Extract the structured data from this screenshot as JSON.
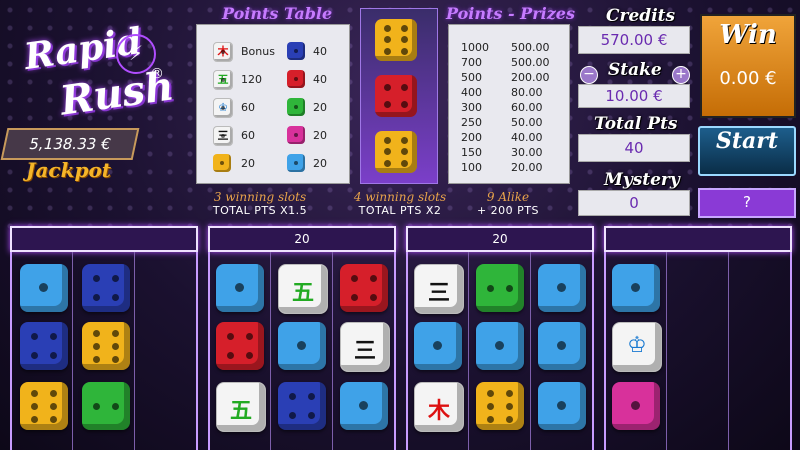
{
  "logo": {
    "line1": "Rapid",
    "line2": "Rush",
    "reg": "®"
  },
  "jackpot": {
    "amount": "5,138.33 €",
    "label": "Jackpot"
  },
  "points_table": {
    "title": "Points Table",
    "rows": [
      {
        "left_icon": "white-kanji-die-icon",
        "left_value": "Bonus",
        "right_icon": "navy-die-icon",
        "right_value": "40"
      },
      {
        "left_icon": "white-leaf-die-icon",
        "left_value": "120",
        "right_icon": "red-die-icon",
        "right_value": "40"
      },
      {
        "left_icon": "white-crown-die-icon",
        "left_value": "60",
        "right_icon": "green-die-icon",
        "right_value": "20"
      },
      {
        "left_icon": "white-wind-die-icon",
        "left_value": "60",
        "right_icon": "pink-die-icon",
        "right_value": "20"
      },
      {
        "left_icon": "yellow-die-icon",
        "left_value": "20",
        "right_icon": "blue-die-icon",
        "right_value": "20"
      }
    ]
  },
  "points_prizes": {
    "title": "Points - Prizes",
    "rows": [
      {
        "points": "1000",
        "prize": "500.00"
      },
      {
        "points": "700",
        "prize": "500.00"
      },
      {
        "points": "500",
        "prize": "200.00"
      },
      {
        "points": "400",
        "prize": "80.00"
      },
      {
        "points": "300",
        "prize": "60.00"
      },
      {
        "points": "250",
        "prize": "50.00"
      },
      {
        "points": "200",
        "prize": "40.00"
      },
      {
        "points": "150",
        "prize": "30.00"
      },
      {
        "points": "100",
        "prize": "20.00"
      }
    ]
  },
  "credits": {
    "label": "Credits",
    "value": "570.00 €"
  },
  "stake": {
    "label": "Stake",
    "value": "10.00 €",
    "minus": "−",
    "plus": "+"
  },
  "total_pts": {
    "label": "Total Pts",
    "value": "40"
  },
  "mystery": {
    "label": "Mystery",
    "value": "0"
  },
  "win": {
    "label": "Win",
    "value": "0.00 €"
  },
  "start_label": "Start",
  "question_label": "?",
  "bonus_lines": [
    {
      "title": "3 winning slots",
      "desc": "TOTAL PTS X1.5"
    },
    {
      "title": "4 winning slots",
      "desc": "TOTAL PTS X2"
    },
    {
      "title": "9 Alike",
      "desc": "+ 200 PTS"
    }
  ],
  "reels": [
    {
      "header": ""
    },
    {
      "header": "20"
    },
    {
      "header": "20"
    },
    {
      "header": ""
    }
  ],
  "colors": {
    "accent": "#b04dff",
    "win": "#f0a43a",
    "start": "#1d5e8c",
    "jackpot_text": "#f5b529"
  }
}
